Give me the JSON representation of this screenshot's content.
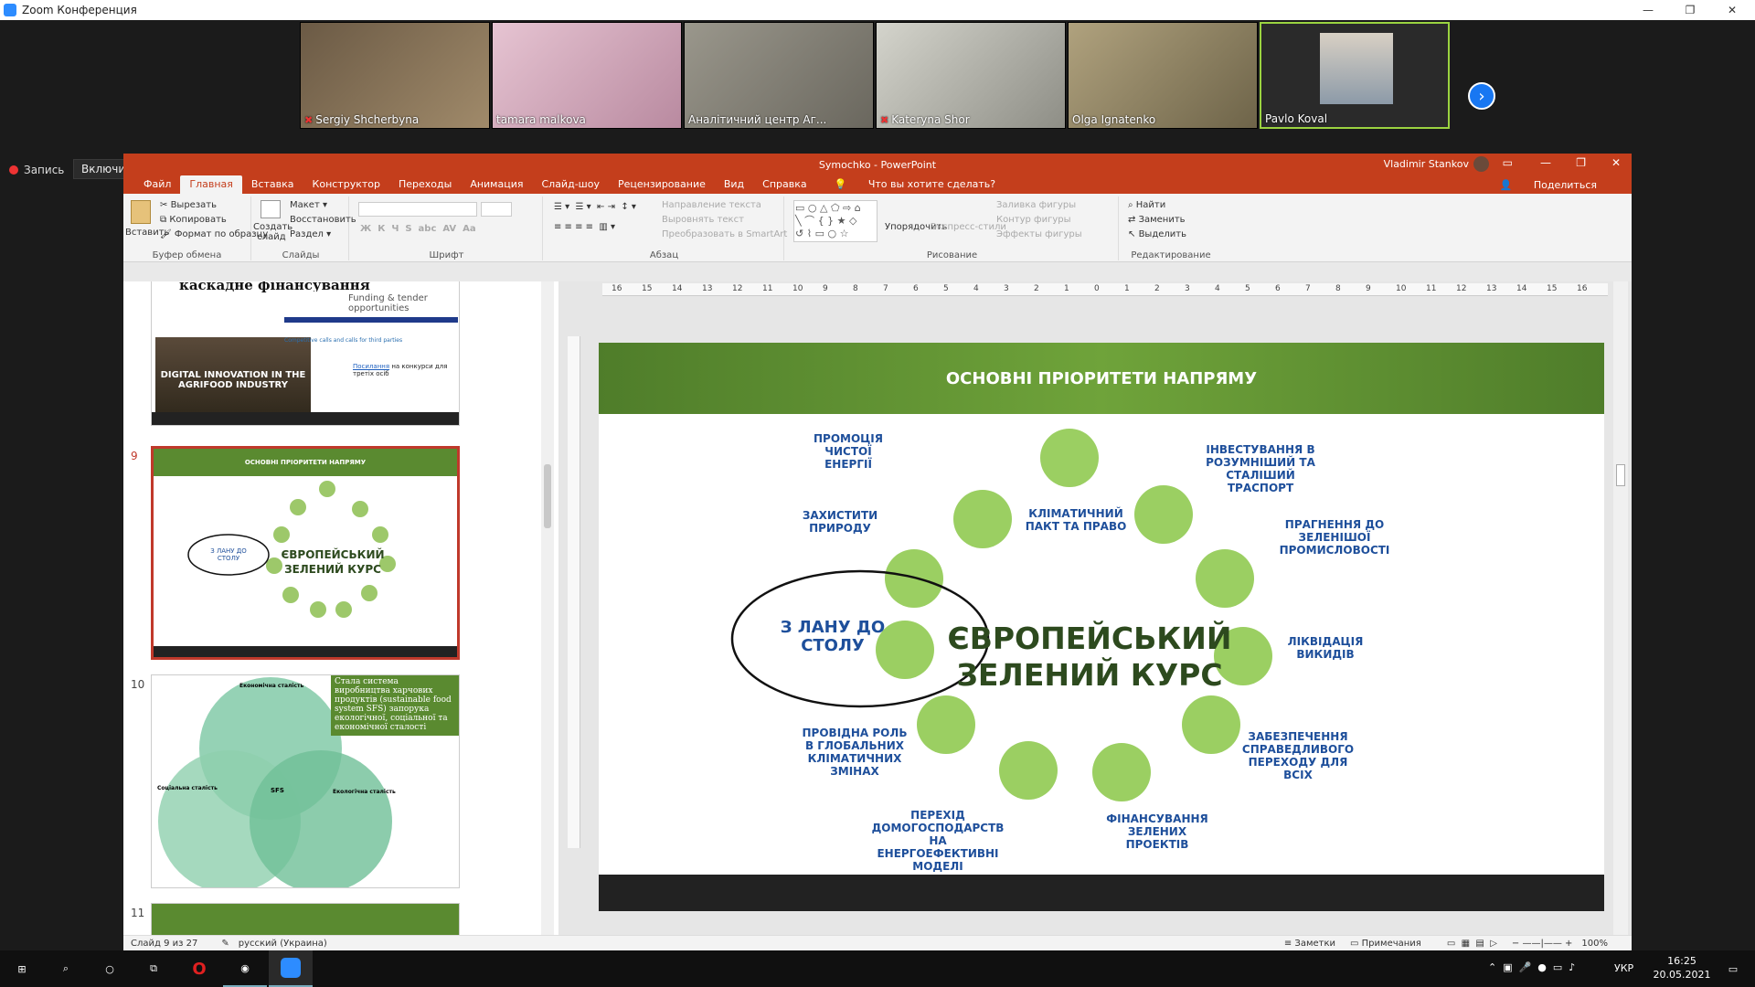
{
  "window": {
    "title": "Zoom Конференция"
  },
  "participants": [
    {
      "name": "Sergiy Shcherbyna",
      "muted": true,
      "bg": "#7a6a55"
    },
    {
      "name": "tamara malkova",
      "muted": false,
      "bg": "#c9a7b8"
    },
    {
      "name": "Аналітичний центр Аг...",
      "muted": false,
      "bg": "#8c8a80"
    },
    {
      "name": "Kateryna Shor",
      "muted": true,
      "bg": "#b8b8b0"
    },
    {
      "name": "Olga Ignatenko",
      "muted": false,
      "bg": "#9c8f70"
    },
    {
      "name": "Pavlo Koval",
      "muted": false,
      "bg": "#2c2c2c"
    }
  ],
  "zoom": {
    "recording_label": "Запись",
    "original_sound_label": "Включить оригинальный звук"
  },
  "ppt": {
    "title": "Symochko - PowerPoint",
    "user": "Vladimir Stankov",
    "tabs": [
      "Файл",
      "Главная",
      "Вставка",
      "Конструктор",
      "Переходы",
      "Анимация",
      "Слайд-шоу",
      "Рецензирование",
      "Вид",
      "Справка"
    ],
    "active_tab": "Главная",
    "tell_me": "Что вы хотите сделать?",
    "share": "Поделиться",
    "ribbon": {
      "paste": "Вставить",
      "cut": "Вырезать",
      "copy": "Копировать",
      "format_painter": "Формат по образцу",
      "clipboard_group": "Буфер обмена",
      "new_slide": "Создать слайд",
      "layout": "Макет",
      "reset": "Восстановить",
      "section": "Раздел",
      "slides_group": "Слайды",
      "font_group": "Шрифт",
      "text_direction": "Направление текста",
      "align_text": "Выровнять текст",
      "smartart": "Преобразовать в SmartArt",
      "paragraph_group": "Абзац",
      "arrange": "Упорядочить",
      "quick_styles": "Экспресс-стили",
      "shape_fill": "Заливка фигуры",
      "shape_outline": "Контур фигуры",
      "shape_effects": "Эффекты фигуры",
      "drawing_group": "Рисование",
      "find": "Найти",
      "replace": "Заменить",
      "select": "Выделить",
      "editing_group": "Редактирование"
    },
    "thumbs": {
      "prev_title": "каскадне фінансування",
      "prev_portal": "Funding & tender opportunities",
      "prev_banner": "DIGITAL INNOVATION IN THE AGRIFOOD INDUSTRY",
      "prev_calls": "Competitive calls and calls for third parties",
      "prev_link": "Посилання",
      "prev_link_rest": "на конкурси для третіх осіб",
      "n9": "9",
      "n10": "10",
      "n11": "11",
      "t9_title": "ОСНОВНІ ПРІОРИТЕТИ НАПРЯМУ",
      "t10_title": "Стала система виробництва харчових продуктів (sustainable food system SFS) запорука екологічної, соціальної та економічної сталості",
      "t10_econ": "Економічна сталість",
      "t10_social": "Соціальна сталість",
      "t10_eco": "Екологічна сталість",
      "t10_sfs": "SFS"
    },
    "slide": {
      "title": "ОСНОВНІ ПРІОРИТЕТИ НАПРЯМУ",
      "center_line1": "ЄВРОПЕЙСЬКИЙ",
      "center_line2": "ЗЕЛЕНИЙ КУРС",
      "farm_line1": "З ЛАНУ ДО",
      "farm_line2": "СТОЛУ",
      "labels": {
        "clean_energy": [
          "ПРОМОЦІЯ",
          "ЧИСТОЇ",
          "ЕНЕРГІЇ"
        ],
        "protect_nature": [
          "ЗАХИСТИТИ",
          "ПРИРОДУ"
        ],
        "climate_pact": [
          "КЛІМАТИЧНИЙ",
          "ПАКТ ТА ПРАВО"
        ],
        "transport": [
          "ІНВЕСТУВАННЯ В",
          "РОЗУМНІШИЙ ТА",
          "СТАЛІШИЙ",
          "ТРАСПОРТ"
        ],
        "industry": [
          "ПРАГНЕННЯ ДО",
          "ЗЕЛЕНІШОЇ",
          "ПРОМИСЛОВОСТІ"
        ],
        "pollution": [
          "ЛІКВІДАЦІЯ",
          "ВИКИДІВ"
        ],
        "global": [
          "ПРОВІДНА РОЛЬ",
          "В ГЛОБАЛЬНИХ",
          "КЛІМАТИЧНИХ",
          "ЗМІНАХ"
        ],
        "just_transition": [
          "ЗАБЕЗПЕЧЕННЯ",
          "СПРАВЕДЛИВОГО",
          "ПЕРЕХОДУ ДЛЯ",
          "ВСІХ"
        ],
        "households": [
          "ПЕРЕХІД",
          "ДОМОГОСПОДАРСТВ",
          "НА ЕНЕРГОЕФЕКТИВНІ",
          "МОДЕЛІ"
        ],
        "finance": [
          "ФІНАНСУВАННЯ",
          "ЗЕЛЕНИХ",
          "ПРОЕКТІВ"
        ]
      }
    },
    "status": {
      "slide": "Слайд 9 из 27",
      "lang": "русский (Украина)",
      "notes": "Заметки",
      "comments": "Примечания",
      "zoom": "100%"
    }
  },
  "taskbar": {
    "time": "16:25",
    "date": "20.05.2021",
    "lang": "УКР"
  }
}
